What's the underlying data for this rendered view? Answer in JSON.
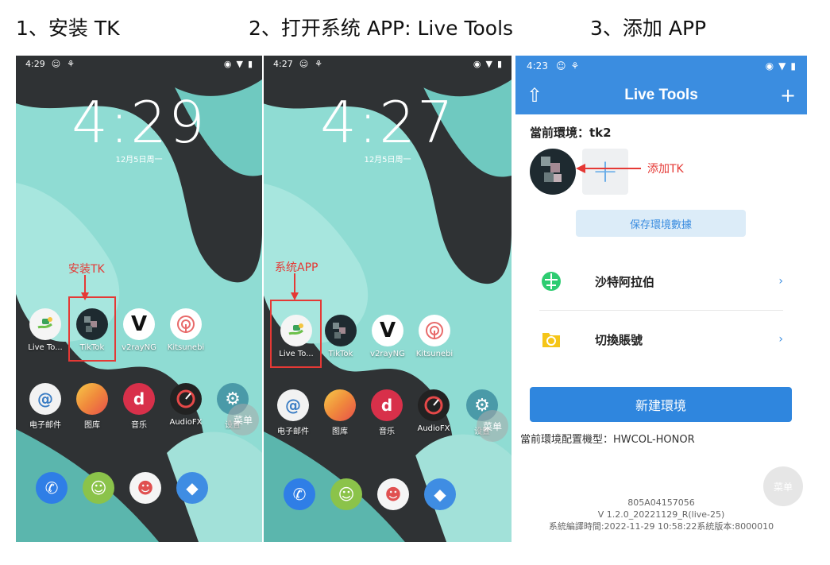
{
  "steps": [
    {
      "title": "1、安装 TK"
    },
    {
      "title": "2、打开系统 APP: Live Tools"
    },
    {
      "title": "3、添加 APP"
    }
  ],
  "screen1": {
    "status_time": "4:29",
    "clock": "4:29",
    "date": "12月5日周一",
    "annotation": "安装TK",
    "apps_row1": [
      "Live To...",
      "TikTok",
      "v2rayNG",
      "Kitsunebi"
    ],
    "apps_row2": [
      "电子邮件",
      "图库",
      "音乐",
      "AudioFX",
      "设置"
    ],
    "menu": "菜单"
  },
  "screen2": {
    "status_time": "4:27",
    "clock": "4:27",
    "date": "12月5日周一",
    "annotation": "系统APP",
    "apps_row1": [
      "Live To...",
      "TikTok",
      "v2rayNG",
      "Kitsunebi"
    ],
    "apps_row2": [
      "电子邮件",
      "图库",
      "音乐",
      "AudioFX",
      "设置"
    ],
    "menu": "菜单"
  },
  "screen3": {
    "status_time": "4:23",
    "app_title": "Live Tools",
    "env_label": "當前環境：tk2",
    "annotation": "添加TK",
    "save_label": "保存環境數據",
    "list": [
      {
        "label": "沙特阿拉伯",
        "icon": "globe-icon"
      },
      {
        "label": "切換賬號",
        "icon": "folder-icon"
      }
    ],
    "new_env_label": "新建環境",
    "model_text": "當前環境配置機型：HWCOL-HONOR",
    "menu": "菜单",
    "footer": [
      "805A04157056",
      "V 1.2.0_20221129_R(live-25)",
      "系統編譯時間:2022-11-29 10:58:22系統版本:8000010"
    ]
  },
  "colors": {
    "accent": "#3b8de0",
    "annotation": "#e53935",
    "teal": "#7fd6cf"
  }
}
